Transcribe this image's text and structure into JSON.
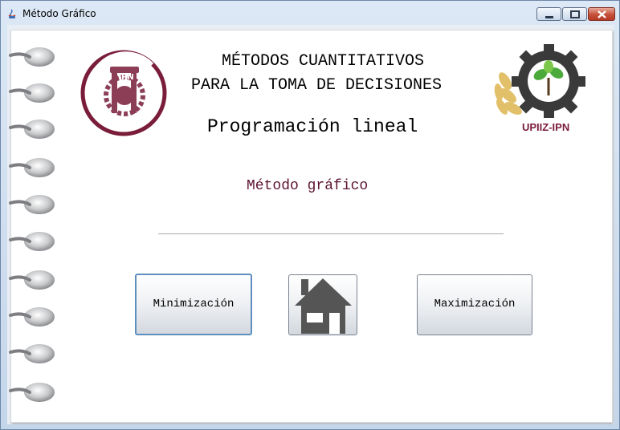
{
  "window": {
    "title": "Método Gráfico"
  },
  "header": {
    "line1": "MÉTODOS CUANTITATIVOS",
    "line2": "PARA LA TOMA DE DECISIONES",
    "subtitle": "Programación lineal",
    "upiiz_label": "UPIIZ-IPN"
  },
  "main": {
    "method_title": "Método gráfico",
    "buttons": {
      "minimize": "Minimización",
      "home_icon": "house-icon",
      "maximize": "Maximización"
    }
  },
  "colors": {
    "accent": "#7a1d3a",
    "method_title": "#5c1230",
    "home_icon": "#555555"
  }
}
